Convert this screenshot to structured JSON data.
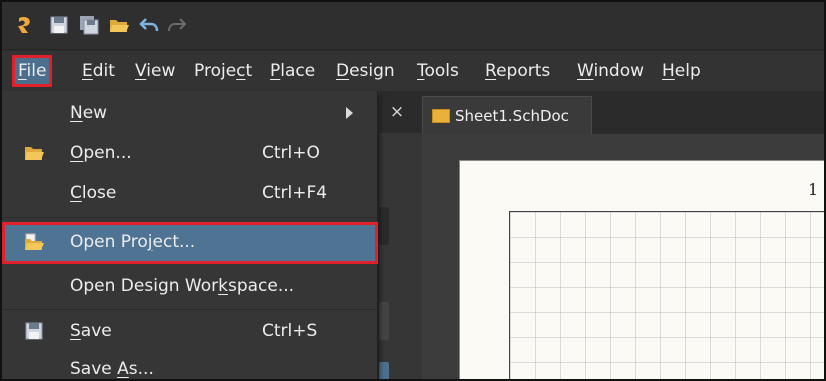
{
  "menubar": {
    "items": [
      {
        "pre": "",
        "u": "F",
        "post": "ile"
      },
      {
        "pre": "",
        "u": "E",
        "post": "dit"
      },
      {
        "pre": "",
        "u": "V",
        "post": "iew"
      },
      {
        "pre": "Proje",
        "u": "c",
        "post": "t"
      },
      {
        "pre": "",
        "u": "P",
        "post": "lace"
      },
      {
        "pre": "",
        "u": "D",
        "post": "esign"
      },
      {
        "pre": "",
        "u": "T",
        "post": "ools"
      },
      {
        "pre": "",
        "u": "R",
        "post": "eports"
      },
      {
        "pre": "",
        "u": "W",
        "post": "indow"
      },
      {
        "pre": "",
        "u": "H",
        "post": "elp"
      }
    ]
  },
  "file_menu": {
    "items": [
      {
        "pre": "",
        "u": "N",
        "post": "ew",
        "shortcut": ""
      },
      {
        "pre": "",
        "u": "O",
        "post": "pen...",
        "shortcut": "Ctrl+O"
      },
      {
        "pre": "",
        "u": "C",
        "post": "lose",
        "shortcut": "Ctrl+F4"
      },
      {
        "pre": "Open Pro",
        "u": "j",
        "post": "ect...",
        "shortcut": ""
      },
      {
        "pre": "Open Design Wor",
        "u": "k",
        "post": "space...",
        "shortcut": ""
      },
      {
        "pre": "",
        "u": "S",
        "post": "ave",
        "shortcut": "Ctrl+S"
      },
      {
        "pre": "Save ",
        "u": "A",
        "post": "s...",
        "shortcut": ""
      }
    ]
  },
  "document_tab": {
    "close_glyph": "×",
    "label": "Sheet1.SchDoc"
  },
  "sheet": {
    "zone_number": "1"
  },
  "colors": {
    "highlight": "#4f7393",
    "annotation_border": "#e0202b",
    "menu_bg": "#363636",
    "sheet_bg": "#fbfaf5"
  }
}
